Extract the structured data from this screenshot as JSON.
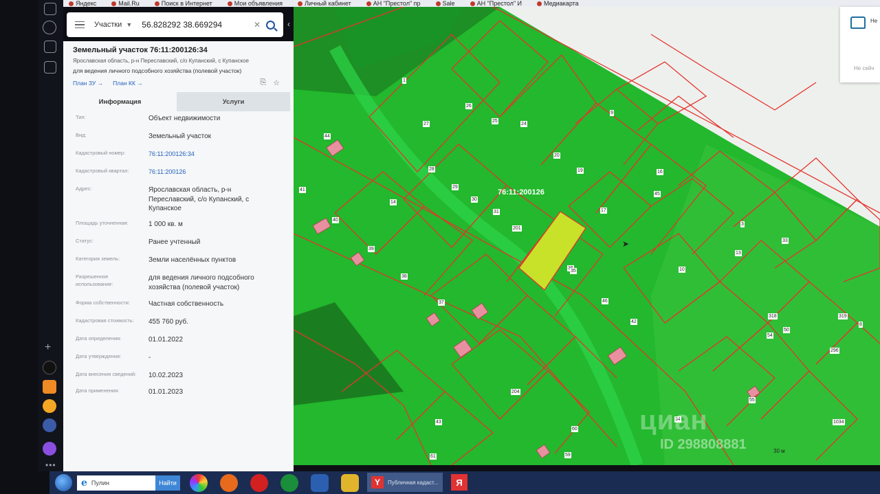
{
  "bookmarks": [
    "Яндекс",
    "Mail.Ru",
    "Поиск в Интернет",
    "Мои объявления",
    "Личный кабинет",
    "АН \"Престол\" пр",
    "Sale",
    "АН \"Престол\" И",
    "Медиакарта"
  ],
  "search": {
    "mode": "Участки",
    "coordinates": "56.828292 38.669294"
  },
  "parcel": {
    "title": "Земельный участок 76:11:200126:34",
    "address_line": "Ярославская область, р-н Переславский, с/о Купанский, с Купанское",
    "use_line": "для ведения личного подсобного хозяйства (полевой участок)",
    "link_plan_zu": "План ЗУ →",
    "link_plan_kk": "План КК →"
  },
  "tabs": [
    {
      "label": "Информация",
      "active": true
    },
    {
      "label": "Услуги",
      "active": false
    }
  ],
  "info_rows": [
    {
      "label": "Тип:",
      "value": "Объект недвижимости",
      "link": false
    },
    {
      "label": "Вид:",
      "value": "Земельный участок",
      "link": false
    },
    {
      "label": "Кадастровый номер:",
      "value": "76:11:200126:34",
      "link": true
    },
    {
      "label": "Кадастровый квартал:",
      "value": "76:11:200126",
      "link": true
    },
    {
      "label": "Адрес:",
      "value": "Ярославская область, р-н Переславский, с/о Купанский, с Купанское",
      "link": false
    },
    {
      "label": "Площадь уточненная:",
      "value": "1 000 кв. м",
      "link": false
    },
    {
      "label": "Статус:",
      "value": "Ранее учтенный",
      "link": false
    },
    {
      "label": "Категория земель:",
      "value": "Земли населённых пунктов",
      "link": false
    },
    {
      "label": "Разрешенное использование:",
      "value": "для ведения личного подсобного хозяйства (полевой участок)",
      "link": false
    },
    {
      "label": "Форма собственности:",
      "value": "Частная собственность",
      "link": false
    },
    {
      "label": "Кадастровая стоимость:",
      "value": "455 760 руб.",
      "link": false
    },
    {
      "label": "Дата определения:",
      "value": "01.01.2022",
      "link": false
    },
    {
      "label": "Дата утверждения:",
      "value": "-",
      "link": false
    },
    {
      "label": "Дата внесения сведений:",
      "value": "10.02.2023",
      "link": false
    },
    {
      "label": "Дата применения:",
      "value": "01.01.2023",
      "link": false
    }
  ],
  "map": {
    "quarter_label": "76:11:200126",
    "parcel_numbers": [
      "1",
      "27",
      "26",
      "25",
      "24",
      "9",
      "44",
      "28",
      "29",
      "30",
      "31",
      "20",
      "19",
      "17",
      "41",
      "14",
      "40",
      "39",
      "38",
      "36",
      "35",
      "37",
      "201",
      "204",
      "43",
      "42",
      "60",
      "59",
      "61",
      "46",
      "45",
      "16",
      "10",
      "13",
      "3",
      "33",
      "34",
      "1034",
      "50",
      "55",
      "54",
      "318",
      "319",
      "296",
      "8"
    ],
    "highlight_color": "#c8e22a",
    "background_color": "#23b82d",
    "boundary_color": "#e5342c",
    "watermark": "циан",
    "watermark_id": "ID 298808881",
    "scale": "30 м"
  },
  "popup": {
    "text": "Не",
    "footer": "Не сейч"
  },
  "taskbar": {
    "search_placeholder": "Пулин",
    "search_button": "Найти",
    "yandex_window": "Публичная кадаст..."
  }
}
